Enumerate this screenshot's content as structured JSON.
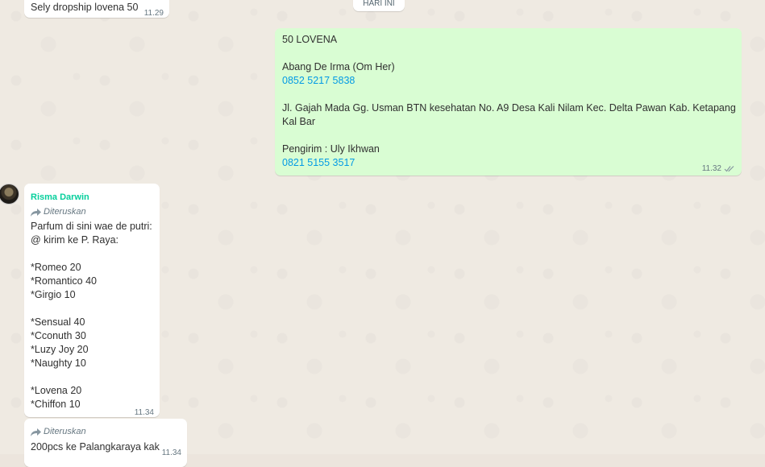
{
  "date_chip": "HARI INI",
  "msg1": {
    "text": "Sely dropship lovena 50",
    "time": "11.29"
  },
  "msg2": {
    "lines": [
      "50 LOVENA",
      "",
      "Abang De Irma (Om Her)",
      "0852 5217 5838",
      "",
      "Jl. Gajah Mada Gg. Usman BTN kesehatan No. A9 Desa Kali Nilam Kec. Delta Pawan Kab. Ketapang",
      "Kal Bar",
      "",
      "Pengirim : Uly Ikhwan",
      "0821 5155 3517"
    ],
    "time": "11.32",
    "status_icon": "double-check-icon"
  },
  "msg3": {
    "sender": "Risma Darwin",
    "forwarded_label": "Diteruskan",
    "lines": [
      "Parfum di sini wae de putri:",
      "@ kirim ke P. Raya:",
      "",
      "*Romeo 20",
      "*Romantico 40",
      "*Girgio 10",
      "",
      "*Sensual 40",
      "*Cconuth 30",
      "*Luzy Joy 20",
      "*Naughty 10",
      "",
      "*Lovena 20",
      "*Chiffon 10"
    ],
    "time": "11.34"
  },
  "msg4": {
    "forwarded_label": "Diteruskan",
    "text": "200pcs ke Palangkaraya kak",
    "time": "11.34"
  },
  "colors": {
    "outgoing": "#d9fdd3",
    "incoming": "#ffffff",
    "link": "#039be5",
    "sender": "#06cf9c"
  }
}
